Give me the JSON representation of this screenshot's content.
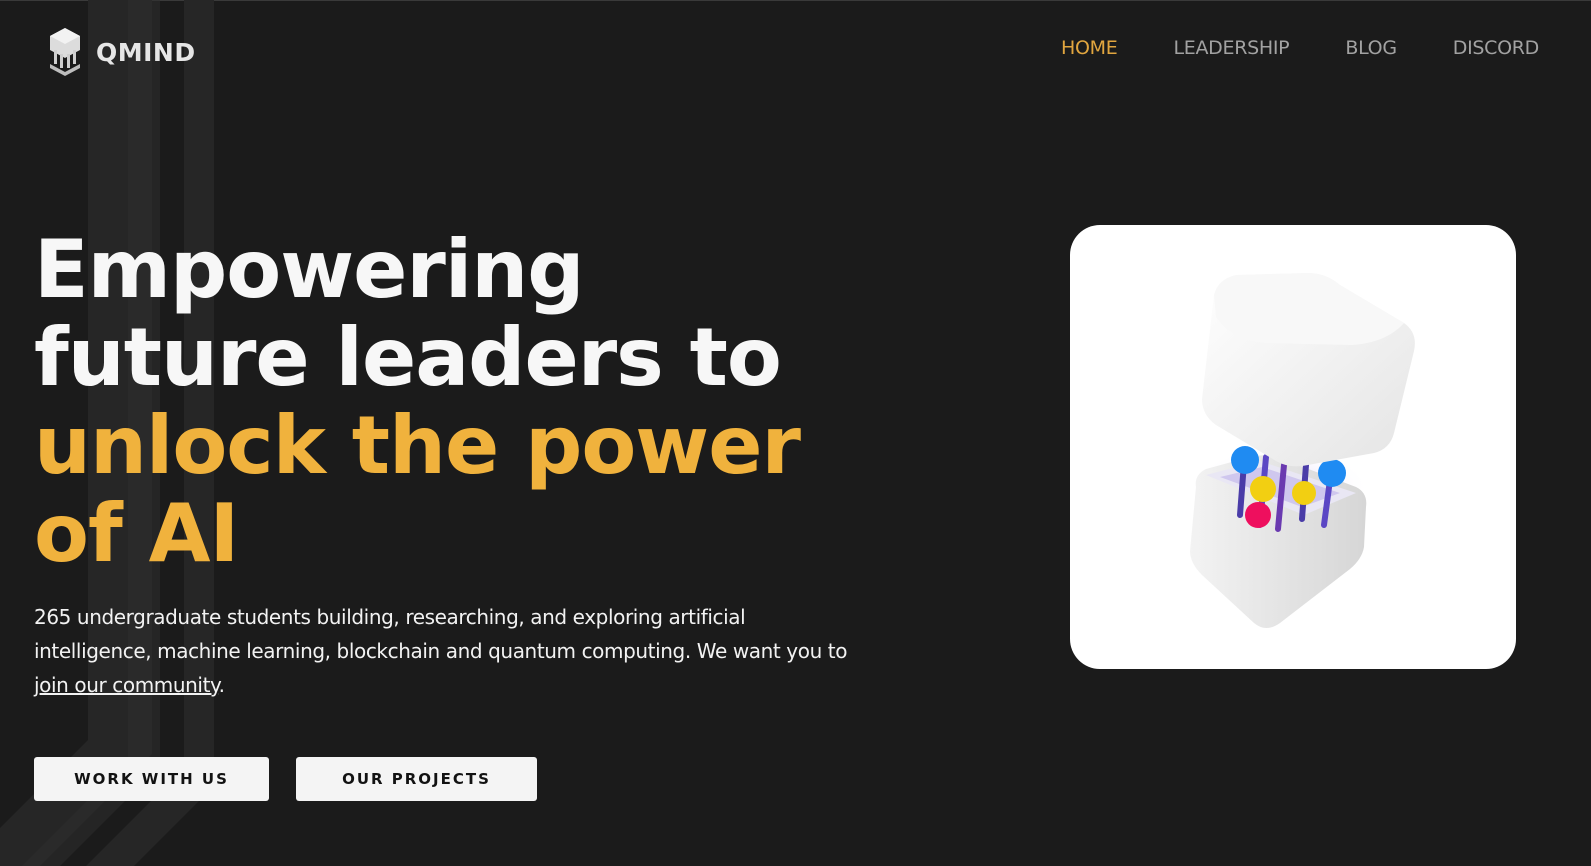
{
  "brand": {
    "name": "QMIND",
    "logo_icon": "qmind-logo-icon"
  },
  "nav": {
    "items": [
      {
        "label": "HOME",
        "active": true
      },
      {
        "label": "LEADERSHIP",
        "active": false
      },
      {
        "label": "BLOG",
        "active": false
      },
      {
        "label": "DISCORD",
        "active": false
      }
    ]
  },
  "hero": {
    "title_lines": [
      "Empowering",
      "future leaders to"
    ],
    "title_accent_lines": [
      "unlock the power",
      "of AI"
    ],
    "description": "265 undergraduate students building, researching, and exploring artificial intelligence, machine learning, blockchain and quantum computing. We want you to",
    "description_link": "join our community",
    "description_end": ".",
    "primary_button": "WORK WITH US",
    "secondary_button": "OUR PROJECTS",
    "image_icon": "quantum-cube-illustration"
  },
  "colors": {
    "background": "#1b1b1b",
    "accent": "#f0b23d",
    "nav_active": "#e2a63f",
    "nav_inactive": "#a2a2a2"
  }
}
